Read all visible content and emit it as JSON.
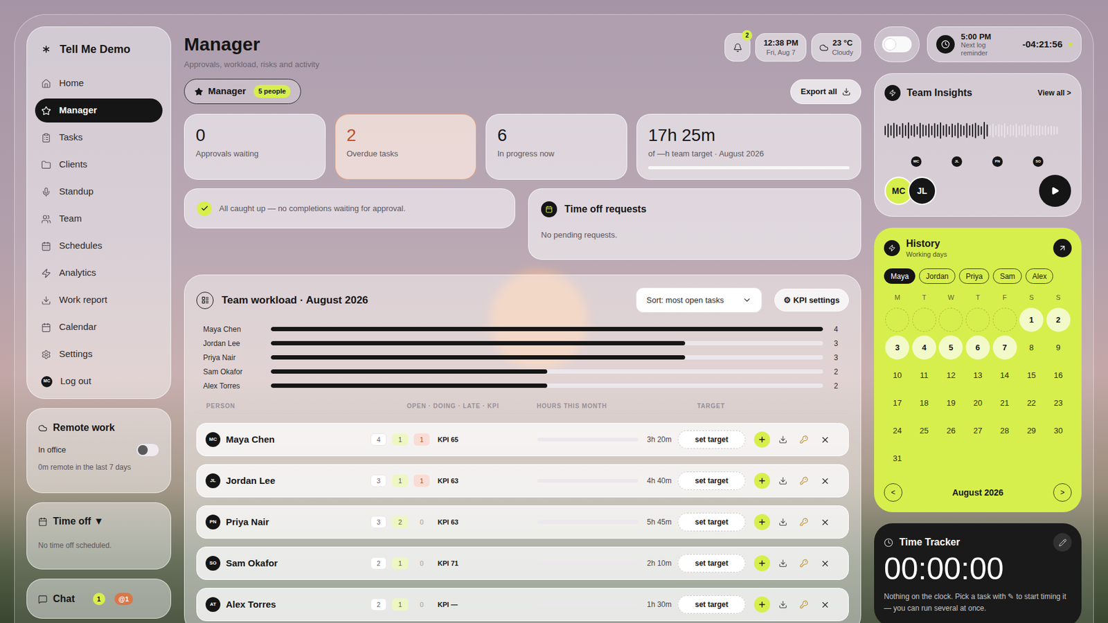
{
  "app": {
    "name": "Tell Me Demo"
  },
  "sidebar": {
    "items": [
      {
        "label": "Home",
        "selected": false
      },
      {
        "label": "Manager",
        "selected": true
      },
      {
        "label": "Tasks",
        "selected": false
      },
      {
        "label": "Clients",
        "selected": false
      },
      {
        "label": "Standup",
        "selected": false
      },
      {
        "label": "Team",
        "selected": false
      },
      {
        "label": "Schedules",
        "selected": false
      },
      {
        "label": "Analytics",
        "selected": false
      },
      {
        "label": "Work report",
        "selected": false
      },
      {
        "label": "Calendar",
        "selected": false
      },
      {
        "label": "Settings",
        "selected": false
      },
      {
        "label": "Log out",
        "selected": false,
        "avatar": "MC"
      }
    ]
  },
  "remote_work": {
    "title": "Remote work",
    "toggle_label": "In office",
    "on": false,
    "note": "0m remote in the last 7 days"
  },
  "time_off_panel": {
    "title": "Time off ▼",
    "note": "No time off scheduled."
  },
  "chat": {
    "label": "Chat",
    "count": "1",
    "mentions": "@1"
  },
  "header": {
    "title": "Manager",
    "subtitle": "Approvals, workload, risks and activity"
  },
  "notifications": {
    "badge": "2"
  },
  "clock": {
    "time": "12:38 PM",
    "date": "Fri, Aug 7"
  },
  "weather": {
    "temperature": "23 °C",
    "condition": "Cloudy"
  },
  "theme_toggle": {
    "on": false
  },
  "reminder": {
    "time": "5:00 PM",
    "label": "Next log reminder",
    "countdown": "-04:21:56",
    "active": true
  },
  "role_filter": {
    "label": "Manager",
    "count": "5 people"
  },
  "export_button": "Export all",
  "stats": [
    {
      "kind": "count",
      "value": "0",
      "label": "Approvals waiting",
      "alert": false
    },
    {
      "kind": "count",
      "value": "2",
      "label": "Overdue tasks",
      "alert": true
    },
    {
      "kind": "count",
      "value": "6",
      "label": "In progress now",
      "alert": false
    },
    {
      "kind": "progress",
      "value": "17h 25m",
      "label": "of —h team target · August 2026",
      "alert": false,
      "level": 0
    }
  ],
  "approvals": {
    "message": "All caught up — no completions waiting for approval."
  },
  "time_off_requests": {
    "title": "Time off requests",
    "message": "No pending requests."
  },
  "workload": {
    "title": "Team workload · August 2026",
    "sort": "Sort: most open tasks",
    "kpi_button": "⚙ KPI settings",
    "axis_max": 4,
    "bars": [
      {
        "name": "Maya Chen",
        "value": 4,
        "label": "4"
      },
      {
        "name": "Jordan Lee",
        "value": 3,
        "label": "3"
      },
      {
        "name": "Priya Nair",
        "value": 3,
        "label": "3"
      },
      {
        "name": "Sam Okafor",
        "value": 2,
        "label": "2"
      },
      {
        "name": "Alex Torres",
        "value": 2,
        "label": "2"
      }
    ]
  },
  "table": {
    "columns": [
      "PERSON",
      "OPEN · DOING · LATE · KPI",
      "HOURS THIS MONTH",
      "TARGET"
    ],
    "rows": [
      {
        "initials": "MC",
        "name": "Maya Chen",
        "open": "4",
        "doing": "1",
        "late": "1",
        "late_alert": true,
        "kpi": "KPI 65",
        "hours": "3h 20m",
        "hours_level": 0,
        "target": "set target"
      },
      {
        "initials": "JL",
        "name": "Jordan Lee",
        "open": "3",
        "doing": "1",
        "late": "1",
        "late_alert": true,
        "kpi": "KPI 63",
        "hours": "4h 40m",
        "hours_level": 0,
        "target": "set target"
      },
      {
        "initials": "PN",
        "name": "Priya Nair",
        "open": "3",
        "doing": "2",
        "late": "0",
        "late_alert": false,
        "kpi": "KPI 63",
        "hours": "5h 45m",
        "hours_level": 0,
        "target": "set target"
      },
      {
        "initials": "SO",
        "name": "Sam Okafor",
        "open": "2",
        "doing": "1",
        "late": "0",
        "late_alert": false,
        "kpi": "KPI 71",
        "hours": "2h 10m",
        "hours_level": 0,
        "target": "set target"
      },
      {
        "initials": "AT",
        "name": "Alex Torres",
        "open": "2",
        "doing": "1",
        "late": "0",
        "late_alert": false,
        "kpi": "KPI —",
        "hours": "1h 30m",
        "hours_level": 0,
        "target": "set target"
      }
    ]
  },
  "team_insights": {
    "title": "Team Insights",
    "view_all": "View all >",
    "progress": 0.6,
    "waveform": [
      0.55,
      0.8,
      0.6,
      0.9,
      0.7,
      0.5,
      0.85,
      0.65,
      0.95,
      0.6,
      0.75,
      0.5,
      0.9,
      0.7,
      0.6,
      0.8,
      0.55,
      0.85,
      0.7,
      0.95,
      0.6,
      0.75,
      0.5,
      0.8,
      0.65,
      0.9,
      0.7,
      0.55,
      0.85,
      0.6,
      0.75,
      0.9,
      0.65,
      0.5,
      1.0,
      0.7,
      0.6,
      0.8,
      0.55,
      0.75,
      0.65,
      0.85,
      0.5,
      0.7,
      0.6,
      0.8,
      0.55,
      0.65,
      0.75,
      0.5,
      0.7,
      0.6,
      0.55,
      0.65,
      0.5,
      0.6,
      0.45,
      0.55,
      0.5,
      0.45
    ],
    "members": [
      "MC",
      "JL",
      "PN",
      "SO"
    ],
    "speakers": [
      {
        "initials": "MC",
        "color": "#d7ef4c"
      },
      {
        "initials": "JL",
        "color": "#161616"
      }
    ]
  },
  "history": {
    "title": "History",
    "subtitle": "Working days",
    "people": [
      {
        "name": "Maya",
        "selected": true
      },
      {
        "name": "Jordan",
        "selected": false
      },
      {
        "name": "Priya",
        "selected": false
      },
      {
        "name": "Sam",
        "selected": false
      },
      {
        "name": "Alex",
        "selected": false
      }
    ],
    "weekdays": [
      "M",
      "T",
      "W",
      "T",
      "F",
      "S",
      "S"
    ],
    "days": [
      {
        "day": "",
        "kind": "blank",
        "worked": false
      },
      {
        "day": "",
        "kind": "blank",
        "worked": false
      },
      {
        "day": "",
        "kind": "blank",
        "worked": false
      },
      {
        "day": "",
        "kind": "blank",
        "worked": false
      },
      {
        "day": "",
        "kind": "blank",
        "worked": false
      },
      {
        "day": "1",
        "kind": "day",
        "worked": true
      },
      {
        "day": "2",
        "kind": "day",
        "worked": true
      },
      {
        "day": "3",
        "kind": "day",
        "worked": true
      },
      {
        "day": "4",
        "kind": "day",
        "worked": true
      },
      {
        "day": "5",
        "kind": "day",
        "worked": true
      },
      {
        "day": "6",
        "kind": "day",
        "worked": true
      },
      {
        "day": "7",
        "kind": "day",
        "worked": true
      },
      {
        "day": "8",
        "kind": "day",
        "worked": false
      },
      {
        "day": "9",
        "kind": "day",
        "worked": false
      },
      {
        "day": "10",
        "kind": "day",
        "worked": false
      },
      {
        "day": "11",
        "kind": "day",
        "worked": false
      },
      {
        "day": "12",
        "kind": "day",
        "worked": false
      },
      {
        "day": "13",
        "kind": "day",
        "worked": false
      },
      {
        "day": "14",
        "kind": "day",
        "worked": false
      },
      {
        "day": "15",
        "kind": "day",
        "worked": false
      },
      {
        "day": "16",
        "kind": "day",
        "worked": false
      },
      {
        "day": "17",
        "kind": "day",
        "worked": false
      },
      {
        "day": "18",
        "kind": "day",
        "worked": false
      },
      {
        "day": "19",
        "kind": "day",
        "worked": false
      },
      {
        "day": "20",
        "kind": "day",
        "worked": false
      },
      {
        "day": "21",
        "kind": "day",
        "worked": false
      },
      {
        "day": "22",
        "kind": "day",
        "worked": false
      },
      {
        "day": "23",
        "kind": "day",
        "worked": false
      },
      {
        "day": "24",
        "kind": "day",
        "worked": false
      },
      {
        "day": "25",
        "kind": "day",
        "worked": false
      },
      {
        "day": "26",
        "kind": "day",
        "worked": false
      },
      {
        "day": "27",
        "kind": "day",
        "worked": false
      },
      {
        "day": "28",
        "kind": "day",
        "worked": false
      },
      {
        "day": "29",
        "kind": "day",
        "worked": false
      },
      {
        "day": "30",
        "kind": "day",
        "worked": false
      },
      {
        "day": "31",
        "kind": "day",
        "worked": false
      }
    ],
    "month": "August 2026",
    "prev": "<",
    "next": ">"
  },
  "time_tracker": {
    "title": "Time Tracker",
    "time": "00:00:00",
    "message": "Nothing on the clock. Pick a task with ✎ to start timing it — you can run several at once."
  }
}
